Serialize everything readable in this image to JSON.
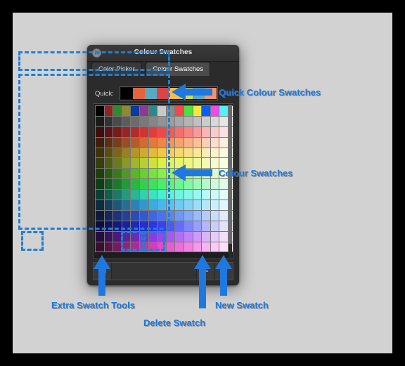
{
  "window": {
    "title": "Colour Swatches",
    "close_icon": "close-icon",
    "tabs": [
      {
        "label": "Color Picker",
        "active": false
      },
      {
        "label": "Colour Swatches",
        "active": true
      }
    ]
  },
  "quick": {
    "label": "Quick:",
    "swatches": [
      "#000000",
      "#e2653c",
      "#59a9c4",
      "#dd4343",
      "#fdbc42",
      "#cfdc4a",
      "#59a9c4",
      "#f79469"
    ]
  },
  "toolbar": {
    "gear_label": "⚙",
    "minus_label": "−",
    "plus_label": "+"
  },
  "annotations": [
    {
      "id": "quick-colour-swatches",
      "text": "Quick Colour Swatches"
    },
    {
      "id": "colour-swatches",
      "text": "Colour Swatches"
    },
    {
      "id": "extra-swatch-tools",
      "text": "Extra Swatch Tools"
    },
    {
      "id": "delete-swatch",
      "text": "Delete Swatch"
    },
    {
      "id": "new-swatch",
      "text": "New Swatch"
    }
  ],
  "colors": {
    "accent": "#1f78e0",
    "highlight_box": "#1f7fd4",
    "canvas_bg": "#d2d2d2",
    "window_bg": "#2b2b2b",
    "frame": "#000000"
  },
  "grid": {
    "columns": 16,
    "rows": 14,
    "rows_data": [
      [
        "#000000",
        "#8f2424",
        "#2d8a2d",
        "#8f8a2b",
        "#0a3a9a",
        "#8a3a8f",
        "#2a8a8a",
        "#c9c9c9",
        "#8a8a8a",
        "#f2484a",
        "#4ce03e",
        "#f8e63f",
        "#0a5ef7",
        "#f049ef",
        "#4ff3f3",
        "#ffffff"
      ],
      [
        "#1a1a1a",
        "#323232",
        "#4a4a4a",
        "#5c5c5c",
        "#6b6b6b",
        "#797979",
        "#868686",
        "#939393",
        "#9e9e9e",
        "#a8a8a8",
        "#b4b4b4",
        "#c0c0c0",
        "#cccccc",
        "#d8d8d8",
        "#e6e6e6",
        "#f4f4f4"
      ],
      [
        "#3e0d0d",
        "#5c1414",
        "#7a1b1b",
        "#9a2323",
        "#b52b2b",
        "#cf3434",
        "#e33c3c",
        "#f04848",
        "#f35a5a",
        "#f56d6d",
        "#f78282",
        "#f99a9a",
        "#fbb3b3",
        "#fccaca",
        "#fde0e0",
        "#fef2f2"
      ],
      [
        "#3e1f0d",
        "#5c2e14",
        "#7a3d1b",
        "#9a4d23",
        "#b55c2b",
        "#cf6c34",
        "#e3793c",
        "#f08548",
        "#f3945a",
        "#f5a36d",
        "#f7b182",
        "#f9c09a",
        "#fbcfb3",
        "#fcdeca",
        "#fdeee0",
        "#fef7f2"
      ],
      [
        "#3e330d",
        "#5c4c14",
        "#7a651b",
        "#9a7f23",
        "#b5942b",
        "#cfa934",
        "#e3ba3c",
        "#f0c748",
        "#f3cf5a",
        "#f5d76d",
        "#f7df82",
        "#f9e79a",
        "#fbedb3",
        "#fcf3ca",
        "#fdf8e0",
        "#fefcf2"
      ],
      [
        "#363e0d",
        "#505c14",
        "#6b7a1b",
        "#889a23",
        "#a0b52b",
        "#b8cf34",
        "#cbe33c",
        "#daf048",
        "#e0f35a",
        "#e6f56d",
        "#ebf782",
        "#f0f99a",
        "#f4fbb3",
        "#f8fcca",
        "#fbfde0",
        "#fefef2"
      ],
      [
        "#1e3e0d",
        "#2c5c14",
        "#3b7a1b",
        "#4c9a23",
        "#5ab52b",
        "#69cf34",
        "#77e33c",
        "#84f048",
        "#94f35a",
        "#a3f56d",
        "#b1f782",
        "#c0f99a",
        "#cffbb3",
        "#defcca",
        "#eefde0",
        "#f7fef2"
      ],
      [
        "#0d3e15",
        "#145c20",
        "#1b7a2b",
        "#239a38",
        "#2bb543",
        "#34cf50",
        "#3ce35c",
        "#48f068",
        "#5af37d",
        "#6df590",
        "#82f7a4",
        "#9af9b7",
        "#b3fbca",
        "#cafcda",
        "#e0fdea",
        "#f2fef6"
      ],
      [
        "#0d3e33",
        "#145c4c",
        "#1b7a65",
        "#239a80",
        "#2bb595",
        "#34cfac",
        "#3ce3c0",
        "#48f0d0",
        "#5af3d9",
        "#6df5e0",
        "#82f7e8",
        "#9af9ee",
        "#b3fbf3",
        "#cafcf7",
        "#e0fdfa",
        "#f2fefd"
      ],
      [
        "#0d2c3e",
        "#14425c",
        "#1b587a",
        "#236f9a",
        "#2b83b5",
        "#3498cf",
        "#3caae3",
        "#48b7f0",
        "#5ac0f3",
        "#6dc9f5",
        "#82d4f7",
        "#9adef9",
        "#b3e7fb",
        "#caeffc",
        "#e0f6fd",
        "#f2fbfe"
      ],
      [
        "#0d1a3e",
        "#14275c",
        "#1b337a",
        "#23409a",
        "#2b4cb5",
        "#3459cf",
        "#3c66e3",
        "#4872f0",
        "#5a86f3",
        "#6d97f5",
        "#82a9f7",
        "#9abaf9",
        "#b3cbfb",
        "#cadcfc",
        "#e0ebfd",
        "#f2f6fe"
      ],
      [
        "#0b0d3e",
        "#10145c",
        "#15197a",
        "#1c209a",
        "#2226b5",
        "#282dcf",
        "#2e33e3",
        "#3a3ff0",
        "#5057f3",
        "#666df5",
        "#7f86f7",
        "#989ef9",
        "#b2b6fb",
        "#c9ccfc",
        "#e0e2fd",
        "#f2f3fe"
      ],
      [
        "#250d3e",
        "#37145c",
        "#481b7a",
        "#5b239a",
        "#6b2bb5",
        "#7b34cf",
        "#883ce3",
        "#9548f0",
        "#a45af3",
        "#b26df5",
        "#bf82f7",
        "#cc9af9",
        "#d9b3fb",
        "#e5cafc",
        "#f1e0fd",
        "#faf2fe"
      ],
      [
        "#3b0d33",
        "#57144b",
        "#741b63",
        "#932380",
        "#ab2b95",
        "#c434ab",
        "#d83cbd",
        "#e648cd",
        "#ea5ad5",
        "#ee6ddc",
        "#f182e3",
        "#f59aeb",
        "#f8b3f1",
        "#facaf6",
        "#fce0fa",
        "#fef2fd"
      ]
    ]
  }
}
